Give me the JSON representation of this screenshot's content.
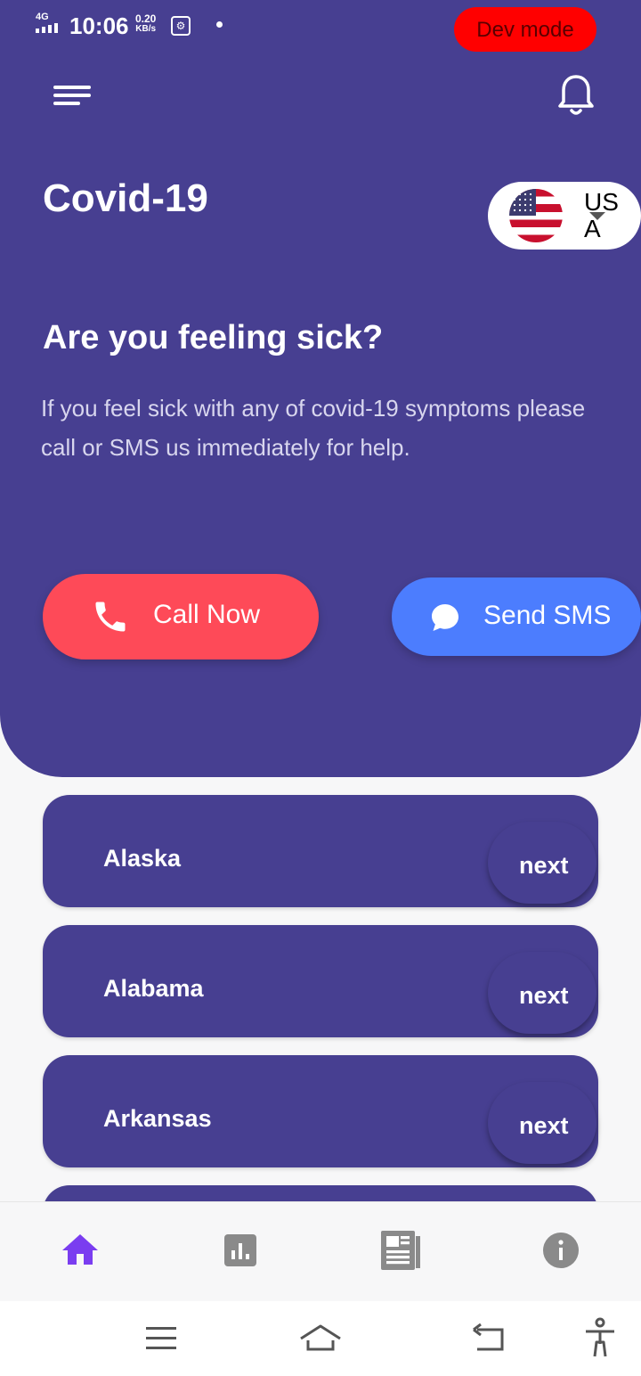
{
  "status_bar": {
    "network": "4G",
    "time": "10:06",
    "speed_value": "0.20",
    "speed_unit": "KB/s",
    "dev_mode_label": "Dev mode"
  },
  "header": {
    "title": "Covid-19",
    "country": {
      "code": "USA",
      "flag_icon": "us-flag-icon"
    },
    "question": "Are you feeling sick?",
    "description": "If you feel sick with any of covid-19 symptoms please call or SMS us immediately for help.",
    "call_button": {
      "label": "Call Now",
      "icon": "phone-icon",
      "color": "#fe4a58"
    },
    "sms_button": {
      "label": "Send SMS",
      "icon": "chat-bubble-icon",
      "color": "#4c7dfe"
    }
  },
  "colors": {
    "primary": "#473f91",
    "active_nav": "#7a3df0",
    "inactive_nav": "#8a8a8a"
  },
  "states": [
    {
      "name": "Alaska",
      "action": "next"
    },
    {
      "name": "Alabama",
      "action": "next"
    },
    {
      "name": "Arkansas",
      "action": "next"
    }
  ],
  "bottom_nav": [
    {
      "icon": "home-icon",
      "active": true
    },
    {
      "icon": "bar-chart-icon",
      "active": false
    },
    {
      "icon": "newspaper-icon",
      "active": false
    },
    {
      "icon": "info-icon",
      "active": false
    }
  ],
  "system_nav": [
    "menu-icon",
    "home-outline-icon",
    "back-icon",
    "accessibility-icon"
  ]
}
